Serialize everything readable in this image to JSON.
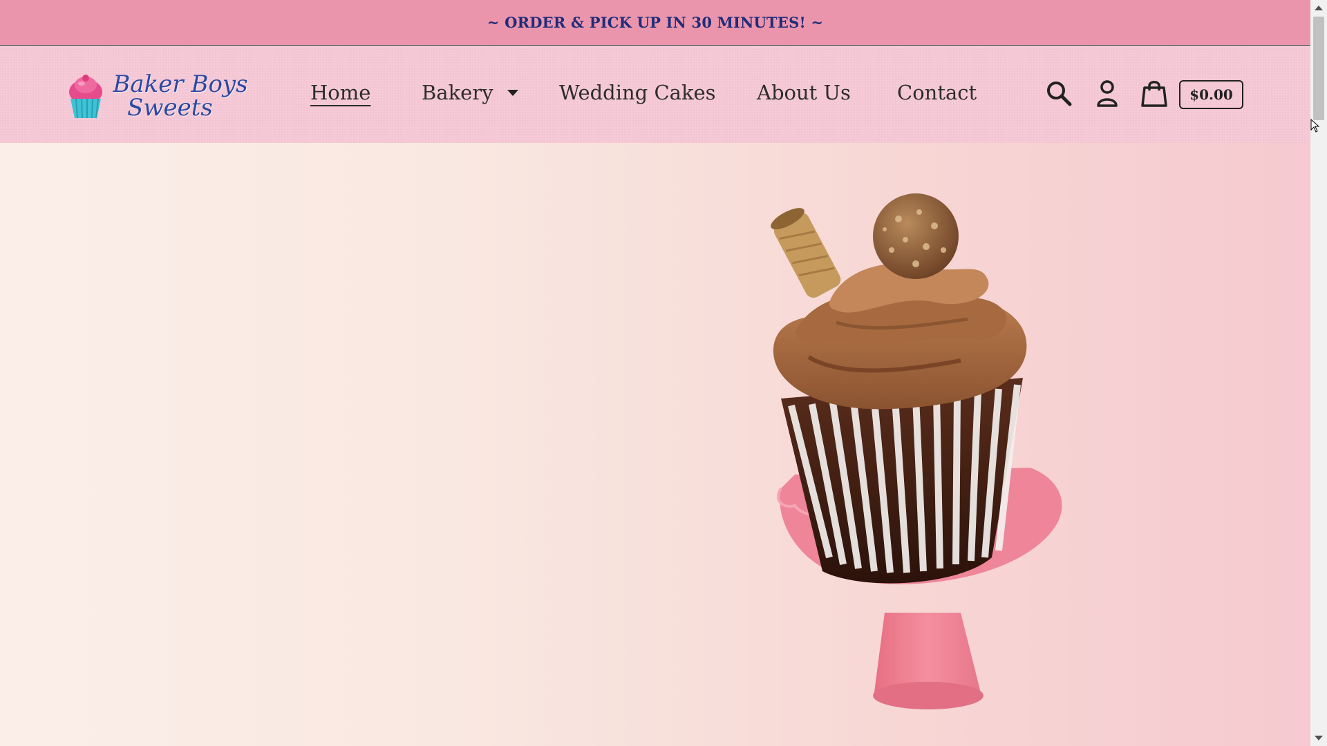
{
  "announcement": {
    "text": "~ ORDER & PICK UP IN 30 MINUTES! ~"
  },
  "brand": {
    "line1": "Baker Boys",
    "line2": "Sweets",
    "logo_icon": "cupcake-icon"
  },
  "nav": {
    "items": [
      {
        "label": "Home",
        "active": true
      },
      {
        "label": "Bakery",
        "has_dropdown": true
      },
      {
        "label": "Wedding Cakes"
      },
      {
        "label": "About Us"
      },
      {
        "label": "Contact"
      }
    ]
  },
  "header_actions": {
    "search_icon": "search-icon",
    "account_icon": "account-icon",
    "cart_icon": "shopping-bag-icon",
    "cart_total": "$0.00"
  },
  "hero": {
    "image": "chocolate-cupcake-on-pink-stand"
  },
  "colors": {
    "announcement_bg": "#eb95ac",
    "announcement_text": "#1f2c7a",
    "header_bg": "#f4c6d4",
    "logo_text": "#2b49a3",
    "nav_text": "#2d2d2d"
  }
}
